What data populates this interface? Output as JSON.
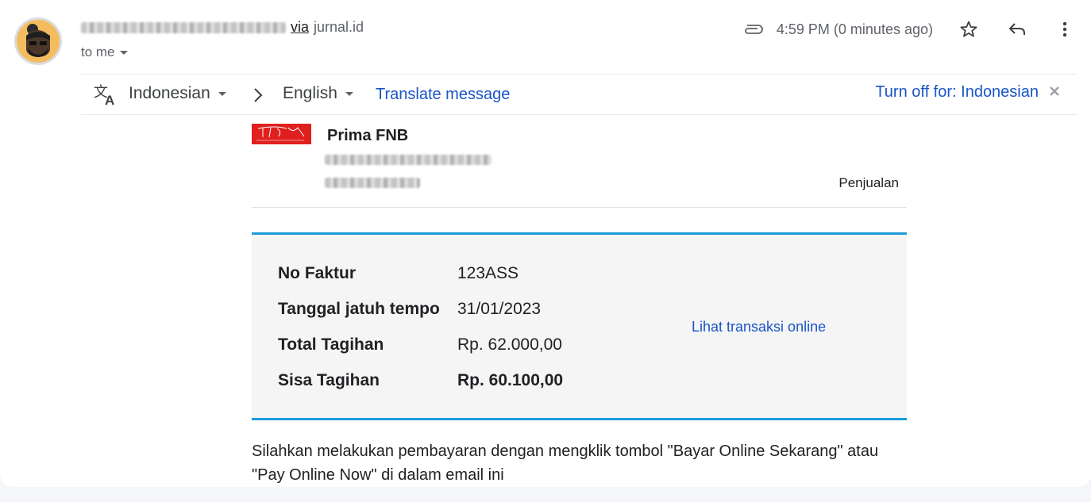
{
  "header": {
    "sender_via": "via",
    "sender_domain": "jurnal.id",
    "to": "to me",
    "time": "4:59 PM (0 minutes ago)"
  },
  "translate": {
    "from_lang": "Indonesian",
    "to_lang": "English",
    "translate_link": "Translate message",
    "turn_off": "Turn off for: Indonesian"
  },
  "email": {
    "company": "Prima FNB",
    "department": "Penjualan",
    "invoice": {
      "rows": [
        {
          "label": "No Faktur",
          "value": "123ASS"
        },
        {
          "label": "Tanggal jatuh tempo",
          "value": "31/01/2023"
        },
        {
          "label": "Total Tagihan",
          "value": "Rp. 62.000,00"
        },
        {
          "label": "Sisa Tagihan",
          "value": "Rp. 60.100,00"
        }
      ],
      "online_link": "Lihat transaksi online"
    },
    "body": "Silahkan melakukan pembayaran dengan mengklik tombol \"Bayar Online Sekarang\" atau \"Pay Online Now\" di dalam email ini"
  },
  "colors": {
    "link": "#1a55c6",
    "accent": "#1d9bd8",
    "logo_red": "#e0201f"
  }
}
